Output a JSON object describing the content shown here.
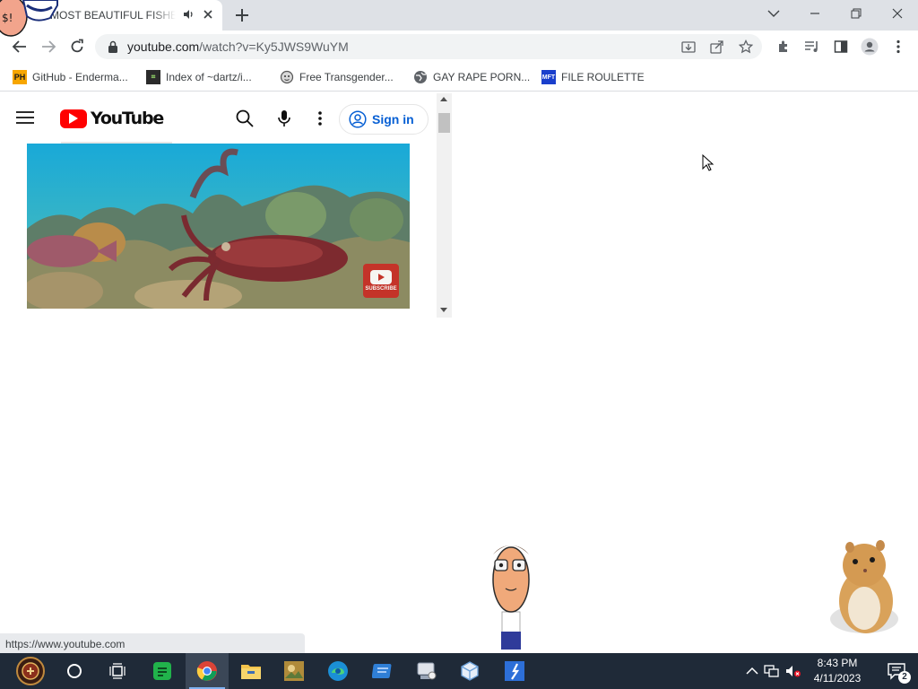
{
  "browser": {
    "tab": {
      "title": "MOST BEAUTIFUL FISHES"
    },
    "address": {
      "host": "youtube.com",
      "path": "/watch?v=Ky5JWS9WuYM"
    },
    "bookmarks": [
      {
        "label": "GitHub - Enderma...",
        "icon": "ph-favicon",
        "color": "#f7a600"
      },
      {
        "label": "Index of ~dartz/i...",
        "icon": "index-favicon",
        "color": "#2b2b2b"
      },
      {
        "label": "Free Transgender...",
        "icon": "face-favicon",
        "color": "#555555"
      },
      {
        "label": "GAY RAPE PORN...",
        "icon": "globe-favicon",
        "color": "#5f6368"
      },
      {
        "label": "FILE ROULETTE",
        "icon": "mft-favicon",
        "color": "#1a3fcc"
      }
    ],
    "status_url": "https://www.youtube.com"
  },
  "youtube": {
    "logo": "YouTube",
    "signin_label": "Sign in",
    "subscribe_text": "SUBSCRIBE",
    "brand_color": "#ff0000",
    "link_color": "#065fd4"
  },
  "taskbar": {
    "apps": [
      "start-button",
      "cortana-search",
      "task-view",
      "spotify-like-app",
      "chrome",
      "file-explorer",
      "image-viewer",
      "edge",
      "notepad-app",
      "mycomputer-app",
      "virtualbox",
      "fl-app"
    ],
    "time": "8:43 PM",
    "date": "4/11/2023",
    "notification_count": "2"
  }
}
